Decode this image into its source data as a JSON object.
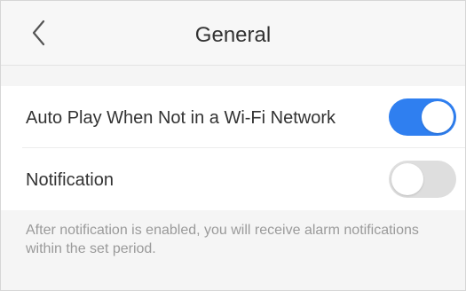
{
  "header": {
    "title": "General",
    "back_icon": "chevron-left-icon"
  },
  "settings": {
    "auto_play": {
      "label": "Auto Play When Not in a Wi-Fi Network",
      "enabled": true
    },
    "notification": {
      "label": "Notification",
      "enabled": false
    }
  },
  "footer_note": "After notification is enabled, you will receive alarm notifications\nwithin the set period.",
  "colors": {
    "accent": "#2f7ff0",
    "toggle_off": "#dedede",
    "background": "#f5f5f5",
    "text": "#333333",
    "muted_text": "#9a9a9a"
  }
}
